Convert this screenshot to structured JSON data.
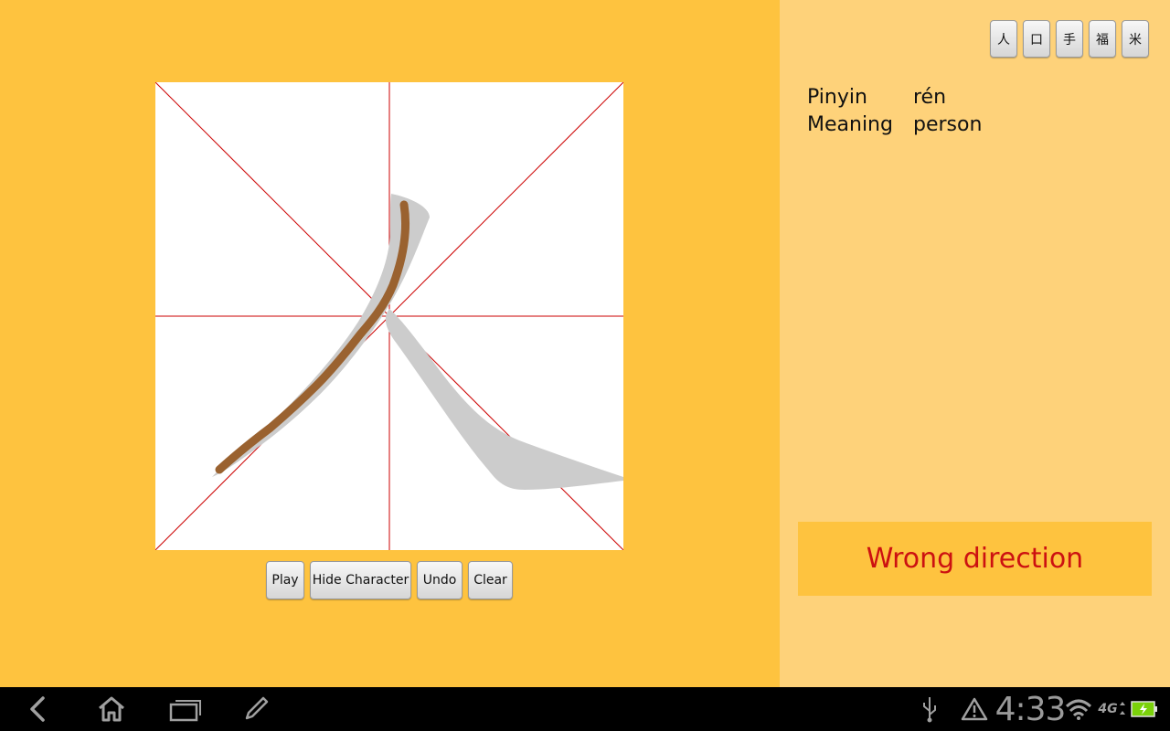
{
  "character_buttons": [
    "人",
    "口",
    "手",
    "福",
    "米"
  ],
  "info": {
    "pinyin_label": "Pinyin",
    "pinyin_value": "rén",
    "meaning_label": "Meaning",
    "meaning_value": "person"
  },
  "controls": {
    "play": "Play",
    "hide_character": "Hide Character",
    "undo": "Undo",
    "clear": "Clear"
  },
  "feedback": "Wrong direction",
  "status_bar": {
    "time": "4:33",
    "network": "4G"
  },
  "colors": {
    "left_bg": "#fec33f",
    "right_bg": "#fed27a",
    "guide_lines": "#cc0000",
    "ghost_character": "#cccccc",
    "user_stroke": "#9a6230",
    "feedback_text": "#cc1111"
  },
  "icons": [
    "back-icon",
    "home-icon",
    "recent-apps-icon",
    "pen-icon",
    "usb-icon",
    "warning-icon",
    "wifi-icon",
    "signal-4g-icon",
    "battery-icon"
  ]
}
